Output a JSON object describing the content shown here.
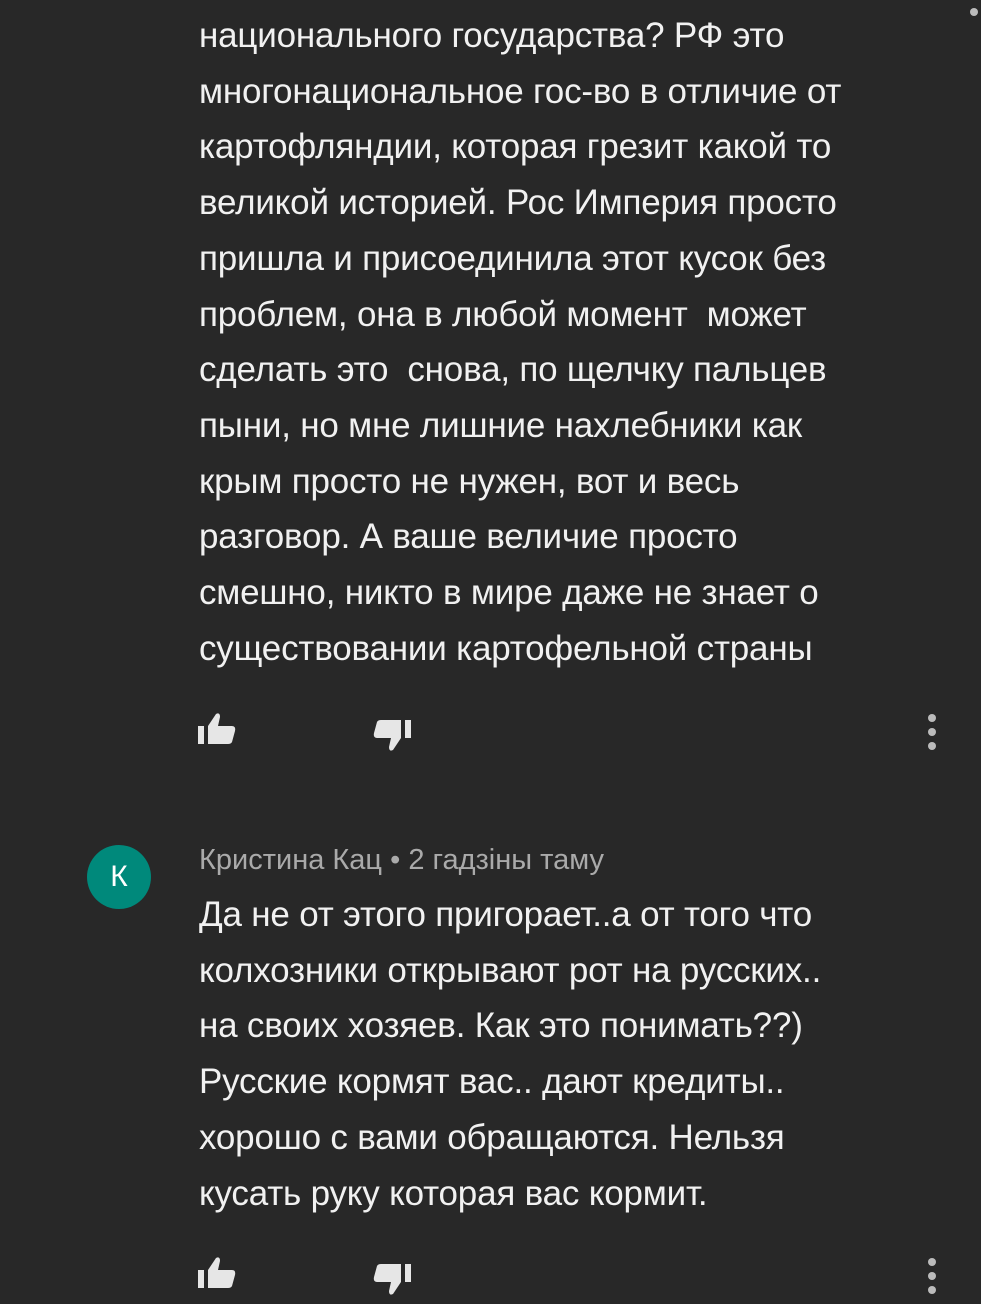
{
  "comments": [
    {
      "text_lines": [
        "национального государства? РФ это",
        "многонациональное гос-во в отличие от",
        "картофляндии, которая грезит какой то",
        "великой историей. Рос Империя просто",
        "пришла и присоединила этот кусок без",
        "проблем, она в любой момент  может",
        "сделать это  снова, по щелчку пальцев",
        "пыни, но мне лишние нахлебники как",
        "крым просто не нужен, вот и весь",
        "разговор. А ваше величие просто",
        "смешно, никто в мире даже не знает о",
        "существовании картофельной страны"
      ],
      "actions": {
        "like_icon": "thumbs-up-icon",
        "dislike_icon": "thumbs-down-icon",
        "menu_icon": "more-vert-icon"
      }
    },
    {
      "avatar_letter": "К",
      "avatar_color": "#00897b",
      "author": "Кристина Кац",
      "separator": "•",
      "time": "2 гадзіны таму",
      "text_lines": [
        "Да не от этого пригорает..а от того что",
        "колхозники открывают рот на русских..",
        "на своих хозяев. Как это понимать??)",
        "Русские кормят вас.. дают кредиты..",
        "хорошо с вами обращаются. Нельзя",
        "кусать руку которая вас кормит."
      ],
      "actions": {
        "like_icon": "thumbs-up-icon",
        "dislike_icon": "thumbs-down-icon",
        "menu_icon": "more-vert-icon"
      }
    }
  ],
  "colors": {
    "background": "#282828",
    "text": "#f1f1f1",
    "meta": "#aaaaaa",
    "icon": "#e6e6e6"
  }
}
